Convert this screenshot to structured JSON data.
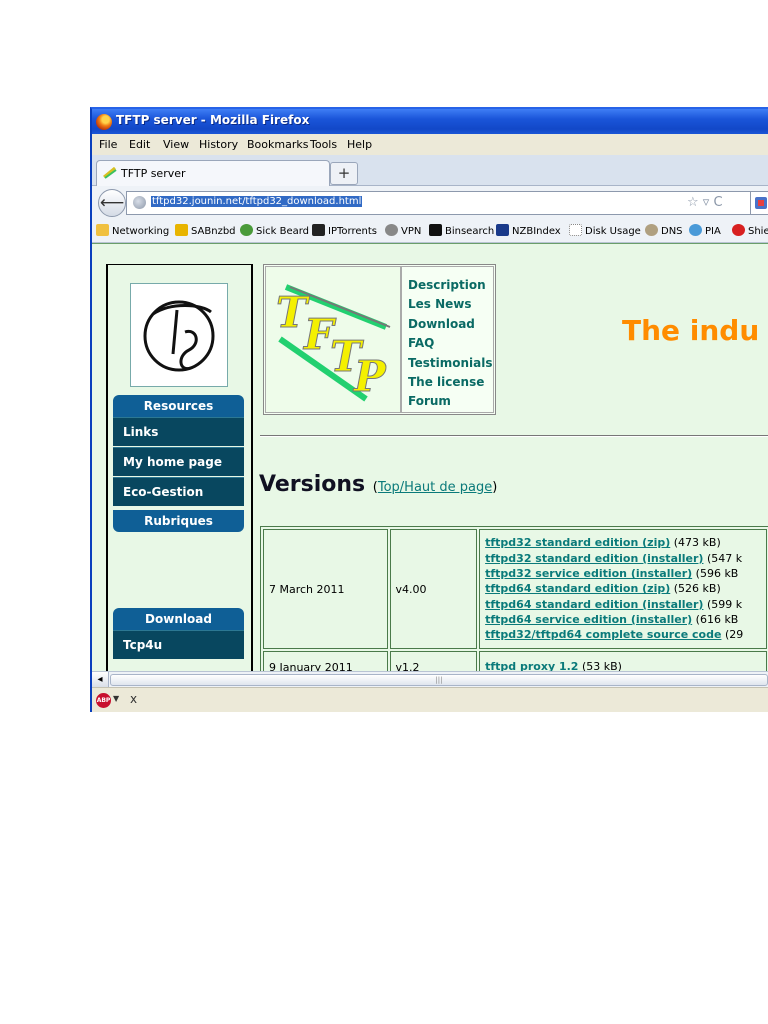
{
  "window": {
    "title": "TFTP server - Mozilla Firefox"
  },
  "menu": [
    "File",
    "Edit",
    "View",
    "History",
    "Bookmarks",
    "Tools",
    "Help"
  ],
  "tab": {
    "label": "TFTP server",
    "new_tab": "+"
  },
  "nav": {
    "back": "⟵",
    "url": "tftpd32.jounin.net/tftpd32_download.html",
    "controls": "☆ ▿ C"
  },
  "bookmarks": [
    {
      "label": "Networking",
      "color": "#f0c040"
    },
    {
      "label": "SABnzbd",
      "color": "#e8b400"
    },
    {
      "label": "Sick Beard",
      "color": "#4a9a3a"
    },
    {
      "label": "IPTorrents",
      "color": "#222222"
    },
    {
      "label": "VPN",
      "color": "#555555"
    },
    {
      "label": "Binsearch",
      "color": "#111111"
    },
    {
      "label": "NZBIndex",
      "color": "#1a3a8a"
    },
    {
      "label": "Disk Usage",
      "color": "#dddddd"
    },
    {
      "label": "DNS",
      "color": "#9a8a6a"
    },
    {
      "label": "PIA",
      "color": "#4a9ad8"
    },
    {
      "label": "Shiel",
      "color": "#d82020"
    }
  ],
  "sidebar": {
    "resources_title": "Resources",
    "resources_items": [
      "Links",
      "My home page",
      "Eco-Gestion"
    ],
    "rubriques_title": "Rubriques",
    "download_title": "Download",
    "download_items": [
      "Tcp4u"
    ]
  },
  "header_menu": [
    "Description",
    "Les News",
    "Download",
    "FAQ",
    "Testimonials",
    "The license",
    "Forum"
  ],
  "logo_text": "TFTP",
  "industry_text": "The indu",
  "versions": {
    "heading": "Versions",
    "top_link": "Top/Haut de page"
  },
  "releases": [
    {
      "date": "7 March 2011",
      "version": "v4.00",
      "files": [
        {
          "name": "tftpd32 standard edition (zip)",
          "size": "(473 kB)"
        },
        {
          "name": "tftpd32 standard edition (installer)",
          "size": "(547 k"
        },
        {
          "name": "tftpd32 service edition (installer)",
          "size": "(596 kB"
        },
        {
          "name": "tftpd64 standard edition (zip)",
          "size": "(526 kB)"
        },
        {
          "name": "tftpd64 standard edition (installer)",
          "size": "(599 k"
        },
        {
          "name": "tftpd64 service edition (installer)",
          "size": "(616 kB"
        },
        {
          "name": "tftpd32/tftpd64 complete source code",
          "size": "(29"
        }
      ]
    },
    {
      "date": "9 January 2011",
      "version": "v1.2",
      "files": [
        {
          "name": "tftpd proxy 1.2",
          "size": "(53 kB)"
        }
      ]
    }
  ],
  "status": {
    "close": "x",
    "adblock": "ABP"
  }
}
